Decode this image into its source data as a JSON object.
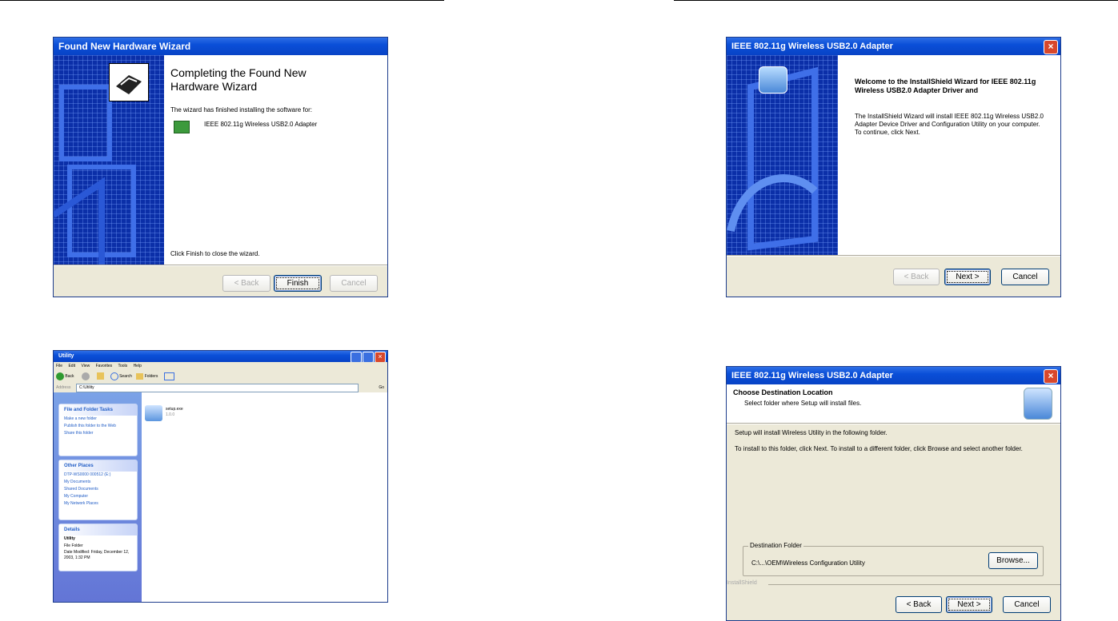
{
  "found_wizard": {
    "title": "Found New Hardware Wizard",
    "heading": "Completing the Found New Hardware Wizard",
    "subtitle": "The wizard has finished installing the software for:",
    "device": "IEEE 802.11g Wireless USB2.0 Adapter",
    "finish_hint": "Click Finish to close the wizard.",
    "back_label": "< Back",
    "finish_label": "Finish",
    "cancel_label": "Cancel"
  },
  "installshield_welcome": {
    "title": "IEEE 802.11g Wireless USB2.0 Adapter",
    "heading": "Welcome to the InstallShield Wizard for IEEE 802.11g Wireless USB2.0 Adapter Driver and",
    "body": "The InstallShield Wizard will install IEEE 802.11g Wireless USB2.0 Adapter Device Driver and Configuration Utility on your computer. To continue, click Next.",
    "back_label": "< Back",
    "next_label": "Next >",
    "cancel_label": "Cancel"
  },
  "explorer": {
    "title": "Utility",
    "menu": [
      "File",
      "Edit",
      "View",
      "Favorites",
      "Tools",
      "Help"
    ],
    "toolbar": {
      "back": "Back",
      "search": "Search",
      "folders": "Folders"
    },
    "address_label": "Address",
    "address_value": "C:\\Utility",
    "go_label": "Go",
    "tasks": {
      "header": "File and Folder Tasks",
      "items": [
        "Make a new folder",
        "Publish this folder to the Web",
        "Share this folder"
      ]
    },
    "other_places": {
      "header": "Other Places",
      "items": [
        "DTP-WS0000 000512 (E:)",
        "My Documents",
        "Shared Documents",
        "My Computer",
        "My Network Places"
      ]
    },
    "details": {
      "header": "Details",
      "name": "Utility",
      "type": "File Folder",
      "modified": "Date Modified: Friday, December 12, 2003, 1:32 PM"
    },
    "file": {
      "name": "setup.exe",
      "sub": "1.0.0"
    }
  },
  "destination": {
    "title": "IEEE 802.11g Wireless USB2.0 Adapter",
    "heading": "Choose Destination Location",
    "subheading": "Select folder where Setup will install files.",
    "line1": "Setup will install Wireless Utility in the following folder.",
    "line2": "To install to this folder, click Next. To install to a different folder, click Browse and select another folder.",
    "group_label": "Destination Folder",
    "path": "C:\\...\\OEM\\Wireless Configuration Utility",
    "browse_label": "Browse...",
    "brand": "InstallShield",
    "back_label": "< Back",
    "next_label": "Next >",
    "cancel_label": "Cancel"
  }
}
